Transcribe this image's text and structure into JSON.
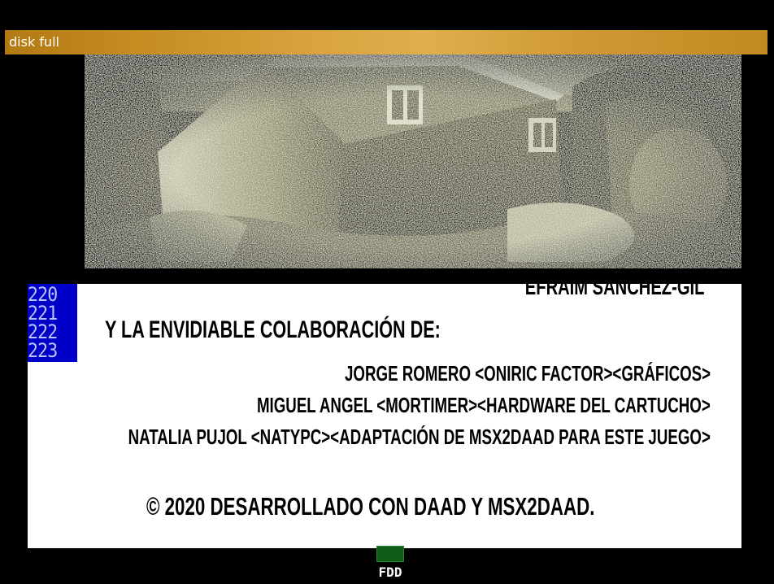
{
  "status_bar": {
    "message": "disk full",
    "color": "#c8901e"
  },
  "scene": {
    "subject": "house-photo",
    "palette": [
      "#000000",
      "#3a3a1e",
      "#7a7850",
      "#b8b89a",
      "#ecece0"
    ]
  },
  "text_window": {
    "line_numbers": [
      "220",
      "221",
      "222",
      "223"
    ],
    "author_line": "EFRAIM SÁNCHEZ-GIL",
    "collab_heading": "Y LA ENVIDIABLE COLABORACIÓN DE:",
    "credits": [
      "JORGE ROMERO <ONIRIC FACTOR><GRÁFICOS>",
      "MIGUEL ANGEL <MORTIMER><HARDWARE DEL CARTUCHO>",
      "NATALIA PUJOL <NATYPC><ADAPTACIÓN DE MSX2DAAD PARA ESTE JUEGO>"
    ],
    "copyright": "© 2020 DESARROLLADO CON DAAD Y MSX2DAAD.",
    "line_number_bg": "#0000c8"
  },
  "drive_indicator": {
    "label": "FDD",
    "led_color": "#0e5a16"
  }
}
